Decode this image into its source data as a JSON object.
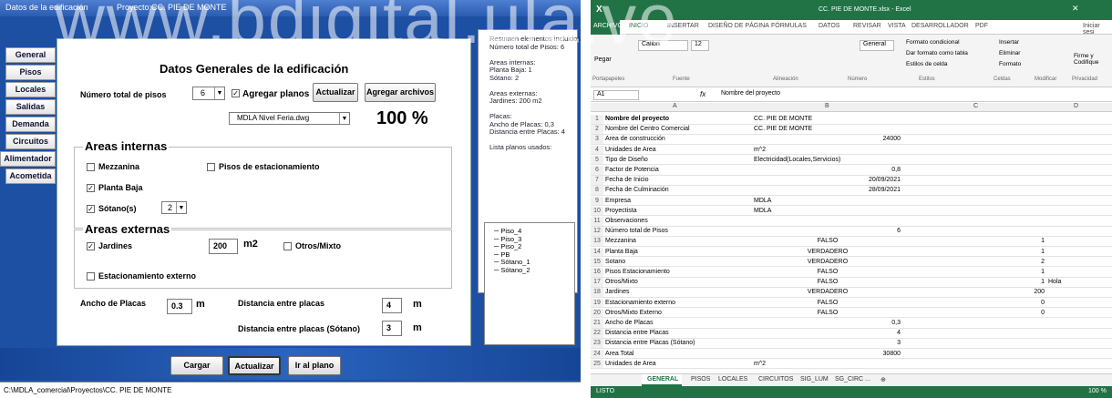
{
  "left_window": {
    "title_left": "Datos de la edificación",
    "title_project": "Proyecto:CC. PIE DE MONTE",
    "nav": [
      "General",
      "Pisos",
      "Locales",
      "Salidas",
      "Demanda",
      "Circuitos",
      "Alimentador",
      "Acometida"
    ],
    "heading": "Datos Generales de la edificación",
    "num_pisos_label": "Número total de pisos",
    "num_pisos_value": "6",
    "agregar_planos": "Agregar planos",
    "actualizar_top": "Actualizar",
    "agregar_archivos": "Agregar archivos",
    "dwg_file": "MDLA Nivel Feria.dwg",
    "percent": "100 %",
    "areas_internas": "Areas internas",
    "mezzanina": "Mezzanina",
    "pisos_estac": "Pisos de estacionamiento",
    "planta_baja": "Planta Baja",
    "sotano": "Sótano(s)",
    "sotano_value": "2",
    "areas_externas": "Areas externas",
    "jardines": "Jardines",
    "jardines_value": "200",
    "m2": "m2",
    "otros_mixto": "Otros/Mixto",
    "estac_externo": "Estacionamiento externo",
    "ancho_placas_label": "Ancho de Placas",
    "ancho_placas_value": "0.3",
    "m": "m",
    "dist_placas_label": "Distancia entre placas",
    "dist_placas_value": "4",
    "dist_sotano_label": "Distancia entre placas (Sótano)",
    "dist_sotano_value": "3",
    "cargar": "Cargar",
    "actualizar": "Actualizar",
    "ir_plano": "Ir al plano",
    "status_path": "C:\\MDLA_comercial\\Proyectos\\CC. PIE DE MONTE",
    "resumen": [
      "Resumen elementos incluidos",
      "Número total de Pisos: 6",
      "",
      "Areas internas:",
      "Planta Baja: 1",
      "Sótano: 2",
      "",
      "Areas externas:",
      "Jardines: 200 m2",
      "",
      "Placas:",
      "Ancho de Placas: 0,3",
      "Distancia entre Placas: 4",
      "",
      "Lista planos usados:"
    ],
    "tree": [
      "Piso_4",
      "Piso_3",
      "Piso_2",
      "PB",
      "Sótano_1",
      "Sótano_2"
    ]
  },
  "excel": {
    "title": "CC. PIE DE MONTE.xlsx - Excel",
    "user": "Iniciar sesi",
    "tabs": [
      "ARCHIVO",
      "INICIO",
      "INSERTAR",
      "DISEÑO DE PÁGINA",
      "FÓRMULAS",
      "DATOS",
      "REVISAR",
      "VISTA",
      "DESARROLLADOR",
      "PDF"
    ],
    "font_name": "Calibri",
    "font_size": "12",
    "groups": [
      "Portapapeles",
      "Fuente",
      "Alineación",
      "Número",
      "Estilos",
      "Celdas",
      "Modificar",
      "Privacidad"
    ],
    "ribbon_items": [
      "Formato condicional",
      "Dar formato como tabla",
      "Estilos de celda",
      "Insertar",
      "Eliminar",
      "Formato",
      "Firme y Codifique",
      "General",
      "Pegar"
    ],
    "name_box": "A1",
    "formula": "Nombre del proyecto",
    "fx": "fx",
    "cols": [
      "A",
      "B",
      "C",
      "D"
    ],
    "rows": [
      {
        "n": "1",
        "a": "Nombre del proyecto",
        "b": "CC. PIE DE MONTE",
        "c": "",
        "d": ""
      },
      {
        "n": "2",
        "a": "Nombre del Centro Comercial",
        "b": "CC. PIE DE MONTE",
        "c": "",
        "d": ""
      },
      {
        "n": "3",
        "a": "Area de construcción",
        "br": "24000",
        "c": "",
        "d": ""
      },
      {
        "n": "4",
        "a": "Unidades de Area",
        "b": "m^2",
        "c": "",
        "d": ""
      },
      {
        "n": "5",
        "a": "Tipo de Diseño",
        "b": "Electricidad(Locales,Servicios)",
        "c": "",
        "d": ""
      },
      {
        "n": "6",
        "a": "Factor de Potencia",
        "br": "0,8",
        "c": "",
        "d": ""
      },
      {
        "n": "7",
        "a": "Fecha de Inicio",
        "br": "20/09/2021",
        "c": "",
        "d": ""
      },
      {
        "n": "8",
        "a": "Fecha de Culminación",
        "br": "28/09/2021",
        "c": "",
        "d": ""
      },
      {
        "n": "9",
        "a": "Empresa",
        "b": "MDLA",
        "c": "",
        "d": ""
      },
      {
        "n": "10",
        "a": "Proyectista",
        "b": "MDLA",
        "c": "",
        "d": ""
      },
      {
        "n": "11",
        "a": "Observaciones",
        "c": "",
        "d": ""
      },
      {
        "n": "12",
        "a": "Número total de Pisos",
        "br": "6",
        "c": "",
        "d": ""
      },
      {
        "n": "13",
        "a": "Mezzanina",
        "bc": "FALSO",
        "c": "1",
        "d": ""
      },
      {
        "n": "14",
        "a": "Planta Baja",
        "bc": "VERDADERO",
        "c": "1",
        "d": ""
      },
      {
        "n": "15",
        "a": "Sotano",
        "bc": "VERDADERO",
        "c": "2",
        "d": ""
      },
      {
        "n": "16",
        "a": "Pisos Estacionamiento",
        "bc": "FALSO",
        "c": "1",
        "d": ""
      },
      {
        "n": "17",
        "a": "Otros/Mixto",
        "bc": "FALSO",
        "c": "1",
        "d": "Hola"
      },
      {
        "n": "18",
        "a": "Jardines",
        "bc": "VERDADERO",
        "c": "200",
        "d": ""
      },
      {
        "n": "19",
        "a": "Estacionamiento externo",
        "bc": "FALSO",
        "c": "0",
        "d": ""
      },
      {
        "n": "20",
        "a": "Otros/Mixto Externo",
        "bc": "FALSO",
        "c": "0",
        "d": ""
      },
      {
        "n": "21",
        "a": "Ancho de Placas",
        "br": "0,3",
        "c": "",
        "d": ""
      },
      {
        "n": "22",
        "a": "Distancia entre Placas",
        "br": "4",
        "c": "",
        "d": ""
      },
      {
        "n": "23",
        "a": "Distancia entre Placas (Sótano)",
        "br": "3",
        "c": "",
        "d": ""
      },
      {
        "n": "24",
        "a": "Area Total",
        "br": "30800",
        "c": "",
        "d": ""
      },
      {
        "n": "25",
        "a": "Unidades de Area",
        "b": "m^2",
        "c": "",
        "d": ""
      }
    ],
    "sheets": [
      "GENERAL",
      "PISOS",
      "LOCALES",
      "CIRCUITOS",
      "SIG_LUM",
      "SG_CIRC ..."
    ],
    "status_left": "LISTO",
    "zoom": "100 %"
  },
  "watermark": "www.bdigital.ula.ve"
}
